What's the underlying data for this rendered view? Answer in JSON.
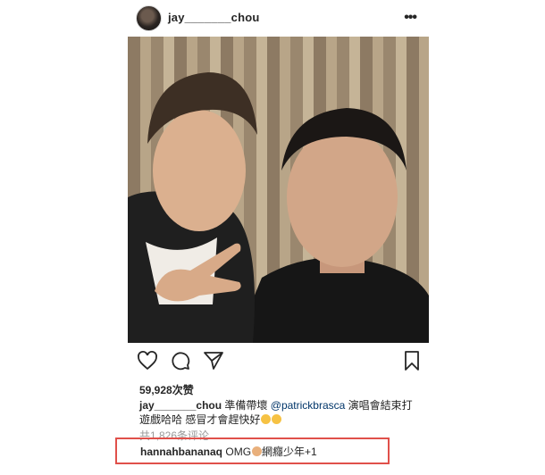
{
  "post": {
    "username": "jay_______chou",
    "likes": "59,928次赞",
    "caption": {
      "username": "jay_______chou",
      "text_before": "準備帶壞",
      "mention": "@patrickbrasca",
      "text_after": "演唱會結束打遊戲哈哈 感冒才會趕快好"
    },
    "comments_link": "共1,826条评论",
    "highlighted_comment": {
      "username": "hannahbananaq",
      "text_before": "OMG",
      "text_after": "網癮少年+1"
    }
  },
  "icons": {
    "more": "more-options-icon",
    "like": "heart-icon",
    "comment": "comment-bubble-icon",
    "share": "paper-plane-icon",
    "save": "bookmark-icon"
  },
  "colors": {
    "highlight_border": "#e0504a",
    "mention": "#003569",
    "muted": "#999999"
  }
}
